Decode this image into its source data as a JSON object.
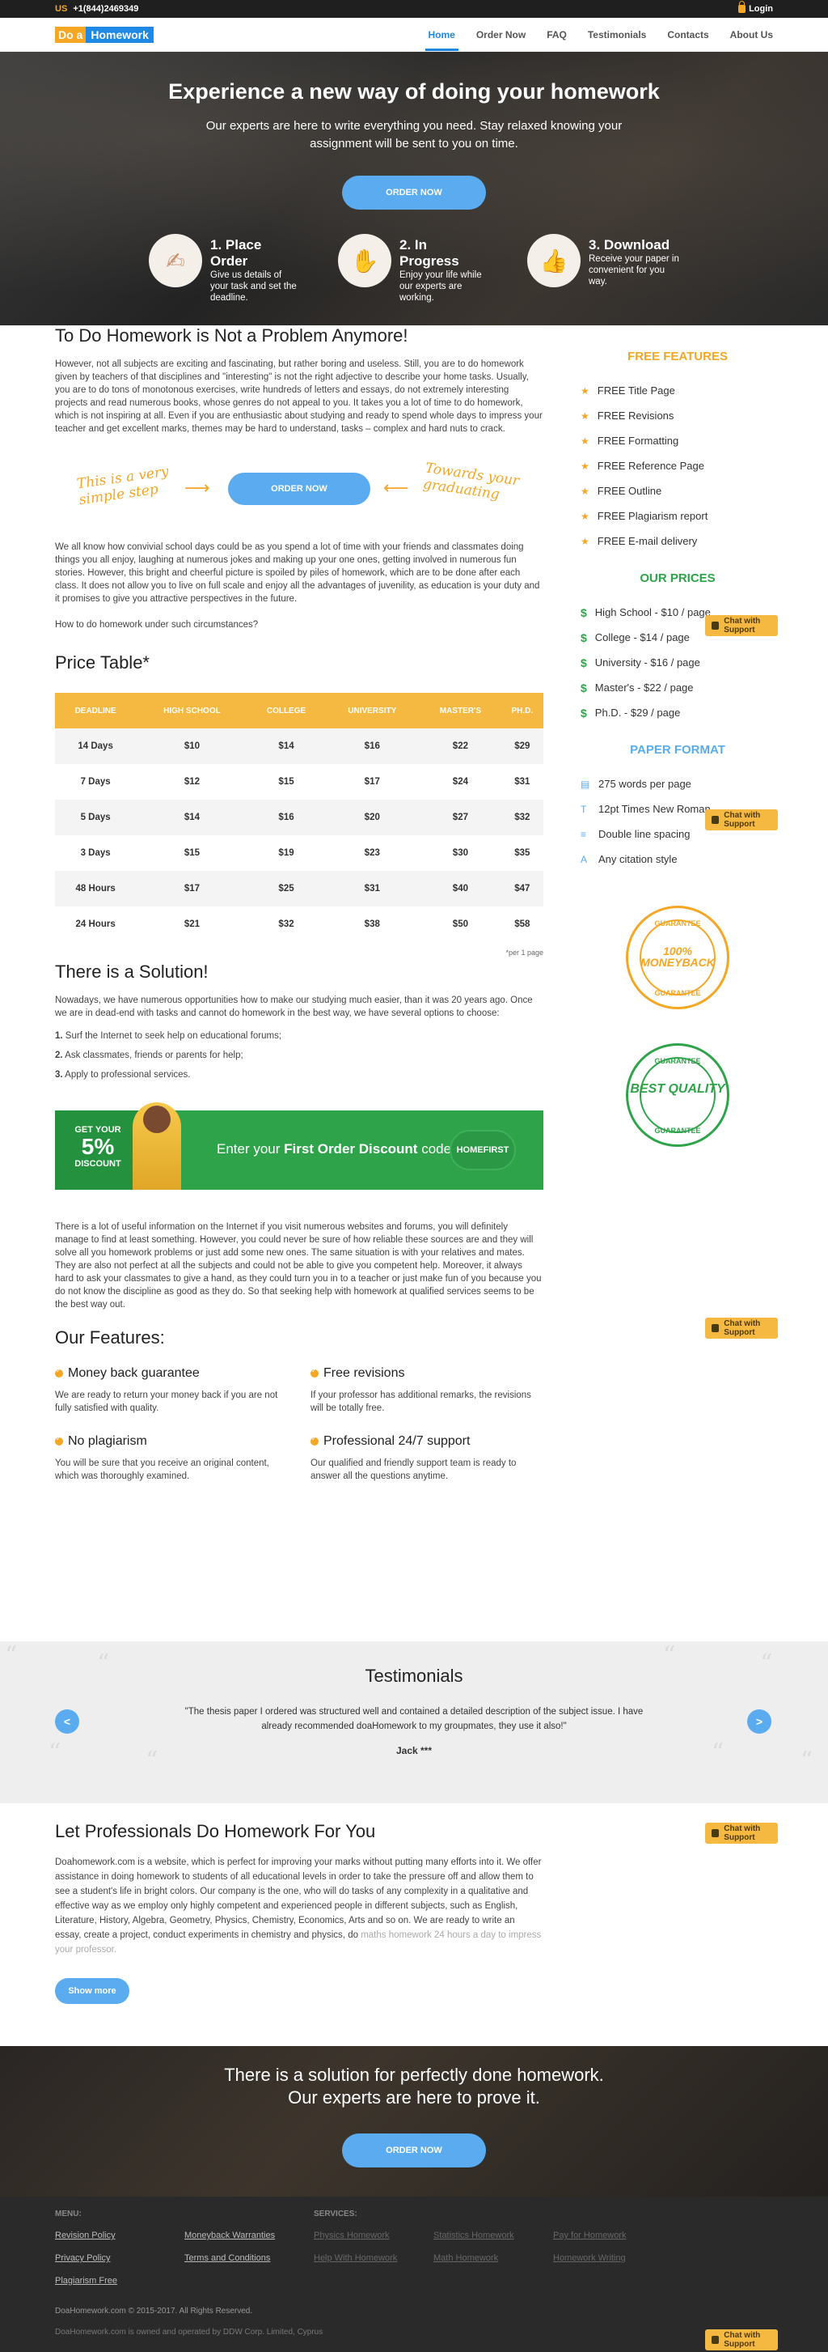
{
  "topbar": {
    "flag": "US",
    "phone": "+1(844)2469349",
    "login": "Login"
  },
  "nav": {
    "logo_a": "Do a",
    "logo_b": "Homework",
    "items": [
      "Home",
      "Order Now",
      "FAQ",
      "Testimonials",
      "Contacts",
      "About Us"
    ]
  },
  "hero": {
    "title": "Experience a new way of doing your homework",
    "subtitle": "Our experts are here to write everything you need. Stay relaxed knowing your assignment will be sent to you on time.",
    "order_btn": "ORDER NOW",
    "steps": [
      {
        "title": "1. Place Order",
        "text": "Give us details of your task and set the deadline."
      },
      {
        "title": "2. In Progress",
        "text": "Enjoy your life while our experts are working."
      },
      {
        "title": "3. Download",
        "text": "Receive your paper in convenient for you way."
      }
    ]
  },
  "intro": {
    "title": "To Do Homework is Not a Problem Anymore!",
    "p1": "However, not all subjects are exciting and fascinating, but rather boring and useless. Still, you are to do homework given by teachers of that disciplines and \"interesting\" is not the right adjective to describe your home tasks. Usually, you are to do tons of monotonous exercises, write hundreds of letters and essays, do not extremely interesting projects and read numerous books, whose genres do not appeal to you. It takes you a lot of time to do homework, which is not inspiring at all. Even if you are enthusiastic about studying and ready to spend whole days to impress your teacher and get excellent marks, themes may be hard to understand, tasks – complex and hard nuts to crack.",
    "hand_left": "This is a very simple step",
    "hand_right": "Towards your graduating",
    "order_btn": "ORDER NOW",
    "p2": "We all know how convivial school days could be as you spend a lot of time with your friends and classmates doing things you all enjoy, laughing at numerous jokes and making up your one ones, getting involved in numerous fun stories. However, this bright and cheerful picture is spoiled by piles of homework, which are to be done after each class. It does not allow you to live on full scale and enjoy all the advantages of juvenility, as education is your duty and it promises to give you attractive perspectives in the future.",
    "p3": "How to do homework under such circumstances?"
  },
  "price_table": {
    "title": "Price Table*",
    "headers": [
      "DEADLINE",
      "HIGH SCHOOL",
      "COLLEGE",
      "UNIVERSITY",
      "MASTER'S",
      "PH.D."
    ],
    "rows": [
      [
        "14 Days",
        "$10",
        "$14",
        "$16",
        "$22",
        "$29"
      ],
      [
        "7 Days",
        "$12",
        "$15",
        "$17",
        "$24",
        "$31"
      ],
      [
        "5 Days",
        "$14",
        "$16",
        "$20",
        "$27",
        "$32"
      ],
      [
        "3 Days",
        "$15",
        "$19",
        "$23",
        "$30",
        "$35"
      ],
      [
        "48 Hours",
        "$17",
        "$25",
        "$31",
        "$40",
        "$47"
      ],
      [
        "24 Hours",
        "$21",
        "$32",
        "$38",
        "$50",
        "$58"
      ]
    ],
    "note": "*per 1 page"
  },
  "solution": {
    "title": "There is a Solution!",
    "p": "Nowadays, we have numerous opportunities how to make our studying much easier, than it was 20 years ago. Once we are in dead-end with tasks and cannot do homework in the best way, we have several options to choose:",
    "options": [
      {
        "num": "1.",
        "text": "Surf the Internet to seek help on educational forums;"
      },
      {
        "num": "2.",
        "text": "Ask classmates, friends or parents for help;"
      },
      {
        "num": "3.",
        "text": "Apply to professional services."
      }
    ]
  },
  "banner": {
    "get_your": "GET YOUR",
    "pct": "5%",
    "discount": "DISCOUNT",
    "text_a": "Enter your ",
    "text_b": "First Order Discount",
    "text_c": " code:",
    "code": "HOMEFIRST"
  },
  "info_p": "There is a lot of useful information on the Internet if you visit numerous websites and forums, you will definitely manage to find at least something. However, you could never be sure of how reliable these sources are and they will solve all you homework problems or just add some new ones. The same situation is with your relatives and mates. They are also not perfect at all the subjects and could not be able to give you competent help. Moreover, it always hard to ask your classmates to give a hand, as they could turn you in to a teacher or just make fun of you because you do not know the discipline as good as they do. So that seeking help with homework at qualified services seems to be the best way out.",
  "features": {
    "title": "Our Features:",
    "items": [
      {
        "title": "Money back guarantee",
        "text": "We are ready to return your money back if you are not fully satisfied with quality."
      },
      {
        "title": "Free revisions",
        "text": "If your professor has additional remarks, the revisions will be totally free."
      },
      {
        "title": "No plagiarism",
        "text": "You will be sure that you receive an original content, which was thoroughly examined."
      },
      {
        "title": "Professional 24/7 support",
        "text": "Our qualified and friendly support team is ready to answer all the questions anytime."
      }
    ]
  },
  "sidebar": {
    "free_title": "FREE FEATURES",
    "free_items": [
      "FREE Title Page",
      "FREE Revisions",
      "FREE Formatting",
      "FREE Reference Page",
      "FREE Outline",
      "FREE Plagiarism report",
      "FREE E-mail delivery"
    ],
    "prices_title": "OUR PRICES",
    "price_items": [
      "High School - $10 / page",
      "College - $14 / page",
      "University - $16 / page",
      "Master's - $22 / page",
      "Ph.D. - $29 / page"
    ],
    "paper_title": "PAPER FORMAT",
    "paper_items": [
      "275 words per page",
      "12pt Times New Roman",
      "Double line spacing",
      "Any citation style"
    ],
    "seal1_top": "GUARANTEE",
    "seal1_main": "100% MONEYBACK",
    "seal1_bottom": "GUARANTEE",
    "seal2_top": "GUARANTEE",
    "seal2_main": "BEST QUALITY",
    "seal2_bottom": "GUARANTEE"
  },
  "chat": {
    "label": "Chat with Support"
  },
  "testimonials": {
    "title": "Testimonials",
    "text": "\"The thesis paper I ordered was structured well and contained a detailed description of the subject issue. I have already recommended doaHomework to my groupmates, they use it also!\"",
    "author": "Jack ***",
    "prev": "<",
    "next": ">"
  },
  "profs": {
    "title": "Let Professionals Do Homework For You",
    "p": "Doahomework.com is a website, which is perfect for improving your marks without putting many efforts into it. We offer assistance in doing homework to students of all educational levels in order to take the pressure off and allow them to see a student's life in bright colors. Our company is the one, who will do tasks of any complexity in a qualitative and effective way as we employ only highly competent and experienced people in different subjects, such as English, Literature, History, Algebra, Geometry, Physics, Chemistry, Economics, Arts and so on. We are ready to write an essay, create a project, conduct experiments in chemistry and physics, do",
    "p_fade": "maths homework 24 hours a day to impress your professor.",
    "show_more": "Show more"
  },
  "cta": {
    "line1": "There is a solution for perfectly done homework.",
    "line2": "Our experts are here to prove it.",
    "btn": "ORDER NOW"
  },
  "footer": {
    "menu_title": "MENU:",
    "services_title": "SERVICES:",
    "menu_links": [
      "Revision Policy",
      "Privacy Policy",
      "Plagiarism Free",
      "Moneyback Warranties",
      "Terms and Conditions"
    ],
    "service_links": [
      "Physics Homework",
      "Help With Homework",
      "Statistics Homework",
      "Math Homework",
      "Pay for Homework",
      "Homework Writing"
    ],
    "copyright": "DoaHomework.com © 2015-2017. All Rights Reserved.",
    "owned": "DoaHomework.com is owned and operated by DDW Corp. Limited, Cyprus"
  }
}
